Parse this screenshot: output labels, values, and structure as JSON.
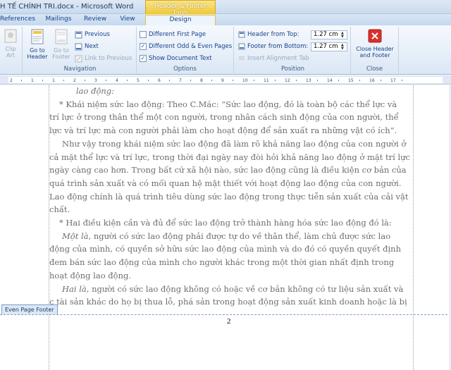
{
  "window": {
    "title": "H TẾ CHÍNH TRI.docx - Microsoft Word",
    "context_tab": "Header & Footer Tools"
  },
  "tabs": [
    {
      "label": "References"
    },
    {
      "label": "Mailings"
    },
    {
      "label": "Review"
    },
    {
      "label": "View"
    },
    {
      "label": "Design",
      "active": true
    }
  ],
  "ribbon": {
    "clip_art": "Clip Art",
    "navigation": {
      "label": "Navigation",
      "go_to_header": "Go to Header",
      "go_to_footer": "Go to Footer",
      "previous": "Previous",
      "next": "Next",
      "link_to_previous": "Link to Previous"
    },
    "options": {
      "label": "Options",
      "different_first_page": {
        "label": "Different First Page",
        "checked": false
      },
      "different_odd_even": {
        "label": "Different Odd & Even Pages",
        "checked": true
      },
      "show_document_text": {
        "label": "Show Document Text",
        "checked": true
      }
    },
    "position": {
      "label": "Position",
      "header_from_top_label": "Header from Top:",
      "header_from_top_value": "1.27 cm",
      "footer_from_bottom_label": "Footer from Bottom:",
      "footer_from_bottom_value": "1.27 cm",
      "insert_alignment_tab": "Insert Alignment Tab"
    },
    "close": {
      "label": "Close",
      "close_button": "Close Header and Footer"
    }
  },
  "ruler": {
    "numbers": [
      "2",
      "1",
      "1",
      "2",
      "3",
      "4",
      "5",
      "6",
      "7",
      "8",
      "9",
      "10",
      "11",
      "12",
      "13",
      "14",
      "15",
      "16",
      "17"
    ]
  },
  "document": {
    "lines": [
      "lao động:",
      "* Khái niệm sức lao động: Theo C.Mác: “Sức lao động, đó là toàn bộ các thể lực và",
      "trí lực ở trong thân thể  một con người, trong nhân cách sinh động của con người, thể",
      "lực và trí lực mà con người phải làm cho hoạt động để sản xuất ra những vật có ích”.",
      "Như vậy trong khái niệm sức lao động đã làm rõ khả năng lao động của con người ở",
      "cả mặt thể lực và trí lực, trong thời đại ngày nay đòi hỏi khả năng lao động ở mặt trí lực",
      "ngày càng cao hơn. Trong bất cứ xã hội nào, sức lao động cũng là điều kiện cơ bản của",
      "quá trình sản xuất và có mối quan hệ mật thiết với hoạt động lao động của con người.",
      "Lao động chính là quá trình tiêu dùng sức lao động trong thực tiễn sản xuất của cải vật",
      "chất.",
      "* Hai điều kiện cần và đủ để sức lao động trở thành hàng hóa sức lao động đó là:",
      "Một là, người có sức lao động phải được tự do về thân thể, làm chủ được sức lao",
      "động của mình, có quyền sở hữu sức lao động của mình và do đó có quyền quyết định",
      "đem bán sức lao động của mình cho người khác trong một thời gian nhất định trong",
      "hoạt động lao động.",
      "Hai là, người có sức lao động không có hoặc về cơ bản không có tư liệu sản xuất và",
      "c tài sản khác do họ bị thua lỗ, phá sản trong hoạt động sản xuất kinh doanh hoặc là bị"
    ],
    "footer_label": "Even Page Footer",
    "page_number": "2"
  },
  "colors": {
    "accent_tab": "#f0c838",
    "ribbon_text": "#15428b",
    "close_icon": "#d9322b"
  }
}
